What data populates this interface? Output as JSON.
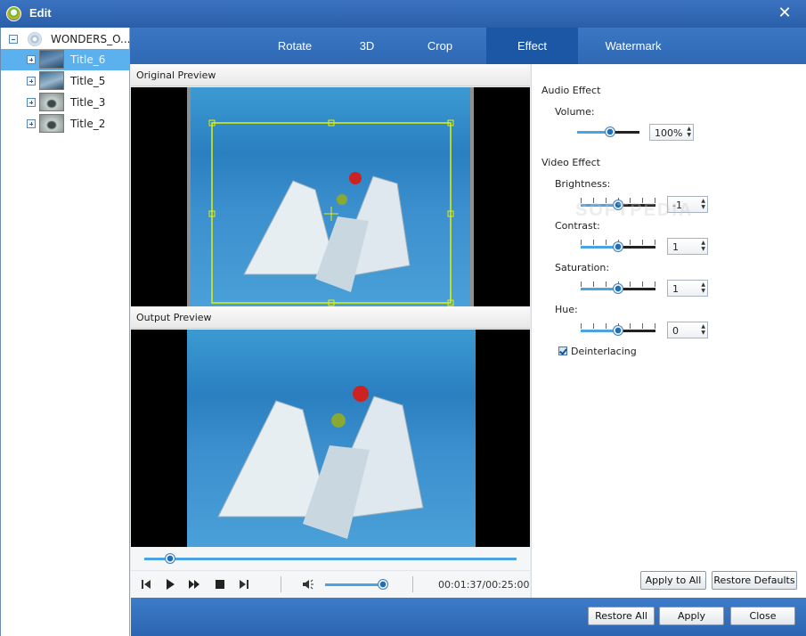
{
  "window": {
    "title": "Edit",
    "close_glyph": "✕"
  },
  "tree": {
    "root_label": "WONDERS_O...",
    "items": [
      {
        "label": "Title_6",
        "selected": true
      },
      {
        "label": "Title_5",
        "selected": false
      },
      {
        "label": "Title_3",
        "selected": false
      },
      {
        "label": "Title_2",
        "selected": false
      }
    ]
  },
  "tabs": [
    {
      "label": "Rotate",
      "active": false
    },
    {
      "label": "3D",
      "active": false
    },
    {
      "label": "Crop",
      "active": false
    },
    {
      "label": "Effect",
      "active": true
    },
    {
      "label": "Watermark",
      "active": false
    }
  ],
  "previews": {
    "original_label": "Original Preview",
    "output_label": "Output Preview"
  },
  "player": {
    "time": "00:01:37/00:25:00",
    "seek_fraction": 0.07,
    "volume_fraction": 0.93,
    "icons": [
      "skip-back-icon",
      "play-icon",
      "fast-forward-icon",
      "stop-icon",
      "skip-forward-icon",
      "volume-icon"
    ]
  },
  "effect": {
    "audio_heading": "Audio Effect",
    "volume_label": "Volume:",
    "volume_value": "100%",
    "video_heading": "Video Effect",
    "brightness_label": "Brightness:",
    "brightness_value": "-1",
    "contrast_label": "Contrast:",
    "contrast_value": "1",
    "saturation_label": "Saturation:",
    "saturation_value": "1",
    "hue_label": "Hue:",
    "hue_value": "0",
    "deinterlacing_label": "Deinterlacing",
    "deinterlacing_checked": true,
    "apply_all_label": "Apply to All",
    "restore_defaults_label": "Restore Defaults"
  },
  "bottom": {
    "restore_all_label": "Restore All",
    "apply_label": "Apply",
    "close_label": "Close"
  },
  "colors": {
    "accent": "#2f69b4",
    "selection": "#5ab1ee",
    "crop_frame": "#e5f000"
  },
  "watermark_text": "SOFTPEDIA"
}
